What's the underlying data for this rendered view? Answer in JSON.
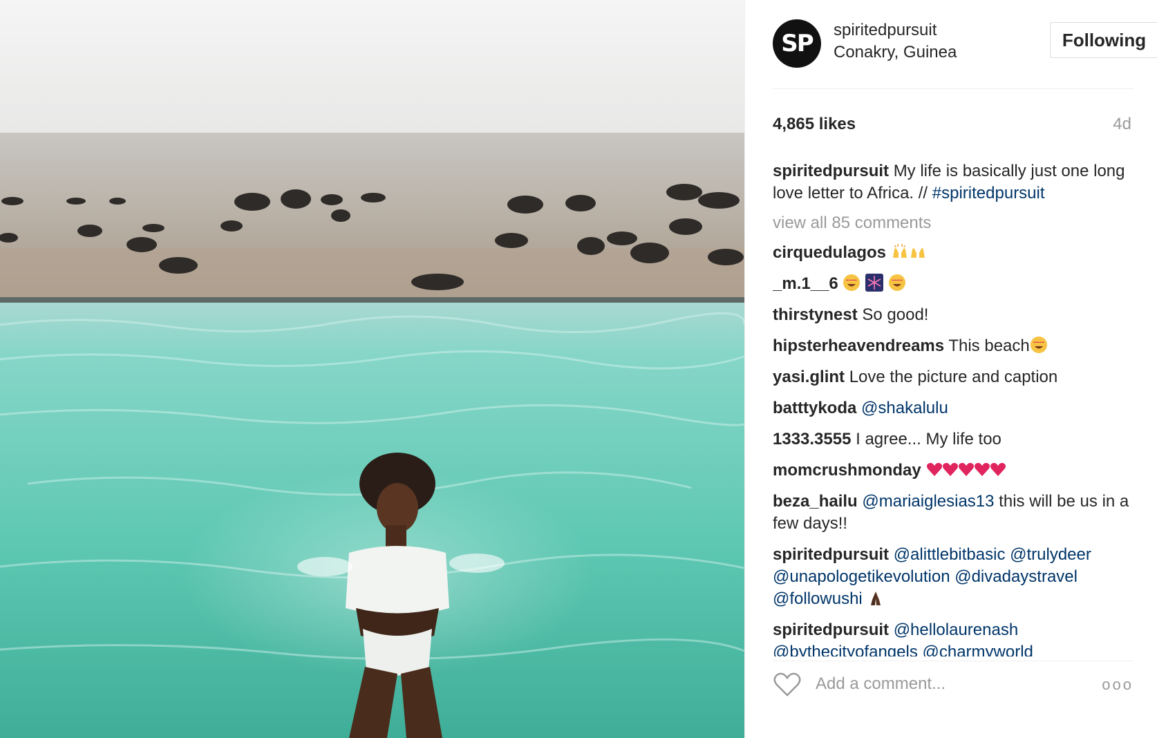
{
  "post": {
    "image_alt": "Woman floating in turquoise infinity pool above rocky beach"
  },
  "header": {
    "avatar_text": "SP",
    "username": "spiritedpursuit",
    "location": "Conakry, Guinea",
    "follow_label": "Following"
  },
  "stats": {
    "likes": "4,865 likes",
    "age": "4d"
  },
  "caption": {
    "user": "spiritedpursuit",
    "text": "My life is basically just one long love letter to Africa. //",
    "hashtag": "#spiritedpursuit"
  },
  "view_all": "view all 85 comments",
  "comments": [
    {
      "user": "cirquedulagos",
      "text": "",
      "emoji": [
        "raised-hands"
      ]
    },
    {
      "user": "_m.1__6",
      "text": "",
      "emoji": [
        "heart-eyes",
        "fireworks",
        "heart-eyes"
      ]
    },
    {
      "user": "thirstynest",
      "text": "So good!",
      "emoji": []
    },
    {
      "user": "hipsterheavendreams",
      "text": "This beach",
      "emoji": [
        "heart-eyes"
      ]
    },
    {
      "user": "yasi.glint",
      "text": "Love the picture and caption",
      "emoji": []
    },
    {
      "user": "batttykoda",
      "mention": "@shakalulu"
    },
    {
      "user": "1333.3555",
      "text": "I agree... My life too",
      "emoji": []
    },
    {
      "user": "momcrushmonday",
      "text": "",
      "emoji": [
        "red-heart",
        "red-heart",
        "red-heart",
        "red-heart",
        "red-heart"
      ]
    },
    {
      "user": "beza_hailu",
      "mention": "@mariaiglesias13",
      "text": "this will be us in a few days!!"
    },
    {
      "user": "spiritedpursuit",
      "mentions": "@alittlebitbasic @trulydeer @unapologetikevolution @divadaystravel @followushi",
      "emoji": [
        "folded-hands"
      ]
    },
    {
      "user": "spiritedpursuit",
      "mentions": "@hellolaurenash @bythecityofangels @charmyworld"
    }
  ],
  "footer": {
    "placeholder": "Add a comment...",
    "more": "ooo"
  },
  "icons": {
    "like": "heart-outline-icon",
    "options": "more-options-icon"
  },
  "colors": {
    "link": "#003569",
    "muted": "#999999",
    "text": "#262626"
  }
}
